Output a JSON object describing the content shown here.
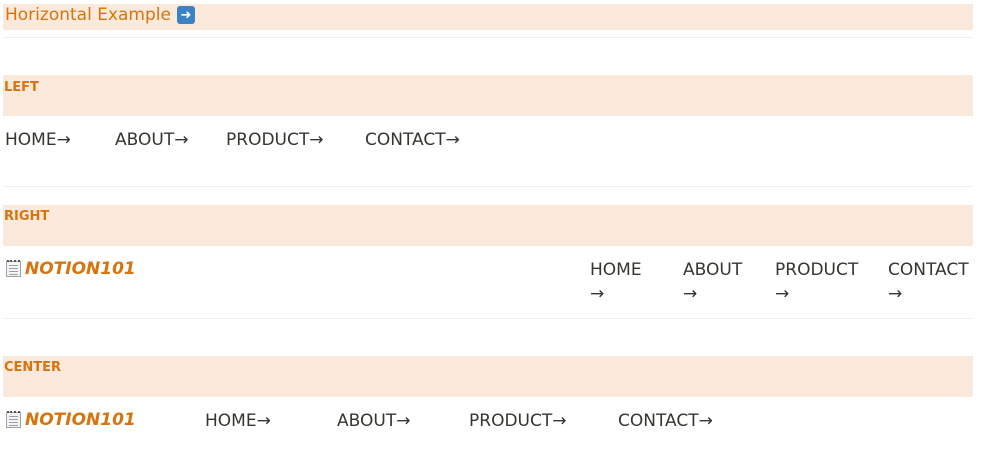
{
  "title": {
    "text": "Horizontal Example",
    "icon": "right-arrow-icon",
    "accent": "#d9730d"
  },
  "sections": {
    "left": {
      "label": "LEFT",
      "nav": [
        "HOME→",
        "ABOUT→",
        "PRODUCT→",
        "CONTACT→"
      ]
    },
    "right": {
      "label": "RIGHT",
      "brand": "NOTION101",
      "nav": [
        {
          "word": "HOME",
          "arrow": "→"
        },
        {
          "word": "ABOUT",
          "arrow": "→"
        },
        {
          "word": "PRODUCT",
          "arrow": "→"
        },
        {
          "word": "CONTACT",
          "arrow": "→"
        }
      ]
    },
    "center": {
      "label": "CENTER",
      "brand": "NOTION101",
      "nav": [
        "HOME→",
        "ABOUT→",
        "PRODUCT→",
        "CONTACT→"
      ]
    }
  },
  "colors": {
    "band": "#fbeadc",
    "label": "#d9730d",
    "text": "#37352f"
  }
}
